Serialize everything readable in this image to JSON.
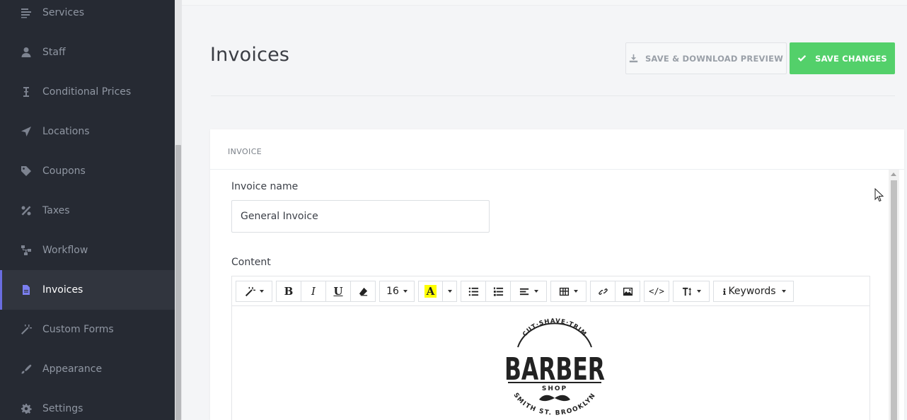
{
  "sidebar": {
    "items": [
      {
        "label": "Services",
        "icon": "list-icon",
        "active": false
      },
      {
        "label": "Staff",
        "icon": "user-icon",
        "active": false
      },
      {
        "label": "Conditional Prices",
        "icon": "text-cursor-icon",
        "active": false
      },
      {
        "label": "Locations",
        "icon": "location-arrow-icon",
        "active": false
      },
      {
        "label": "Coupons",
        "icon": "tag-icon",
        "active": false
      },
      {
        "label": "Taxes",
        "icon": "percent-icon",
        "active": false
      },
      {
        "label": "Workflow",
        "icon": "sitemap-icon",
        "active": false
      },
      {
        "label": "Invoices",
        "icon": "file-icon",
        "active": true
      },
      {
        "label": "Custom Forms",
        "icon": "magic-wand-icon",
        "active": false
      },
      {
        "label": "Appearance",
        "icon": "brush-icon",
        "active": false
      },
      {
        "label": "Settings",
        "icon": "gear-icon",
        "active": false
      }
    ]
  },
  "header": {
    "title": "Invoices",
    "preview_button": "SAVE & DOWNLOAD PREVIEW",
    "save_button": "SAVE CHANGES"
  },
  "card": {
    "title": "INVOICE",
    "invoice_name_label": "Invoice name",
    "invoice_name_value": "General Invoice",
    "content_label": "Content"
  },
  "editor": {
    "font_size": "16",
    "highlight_letter": "A",
    "keywords_label": "Keywords",
    "code_label": "</>",
    "bold": "B",
    "italic": "I",
    "underline": "U"
  },
  "logo": {
    "top_arc": "CUT·SHAVE·TRIM",
    "main": "BARBER",
    "sub": "SHOP",
    "bottom_arc": "SMITH ST. BROOKLYN"
  },
  "colors": {
    "sidebar_bg": "#262a33",
    "accent": "#6a6de0",
    "save_green": "#53d06a"
  }
}
